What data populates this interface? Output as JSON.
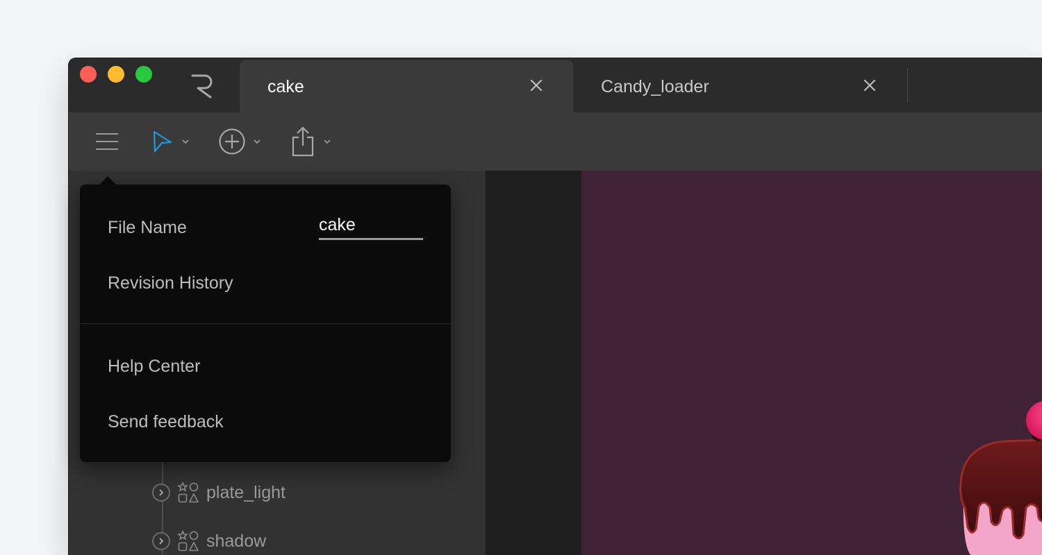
{
  "tabs": [
    {
      "label": "cake",
      "active": true
    },
    {
      "label": "Candy_loader",
      "active": false
    }
  ],
  "toolbar": {
    "menu_icon": "hamburger-icon",
    "select_icon": "cursor-arrow-icon",
    "add_icon": "plus-circle-icon",
    "share_icon": "share-icon",
    "accent_color": "#1a9bdc"
  },
  "popup": {
    "file_name_label": "File Name",
    "file_name_value": "cake",
    "revision_history": "Revision History",
    "help_center": "Help Center",
    "send_feedback": "Send feedback"
  },
  "tree": [
    {
      "label": "plate_light"
    },
    {
      "label": "shadow"
    }
  ],
  "colors": {
    "canvas_bg": "#3f2233",
    "traffic_close": "#fe5f57",
    "traffic_min": "#febc2e",
    "traffic_max": "#28c840"
  }
}
